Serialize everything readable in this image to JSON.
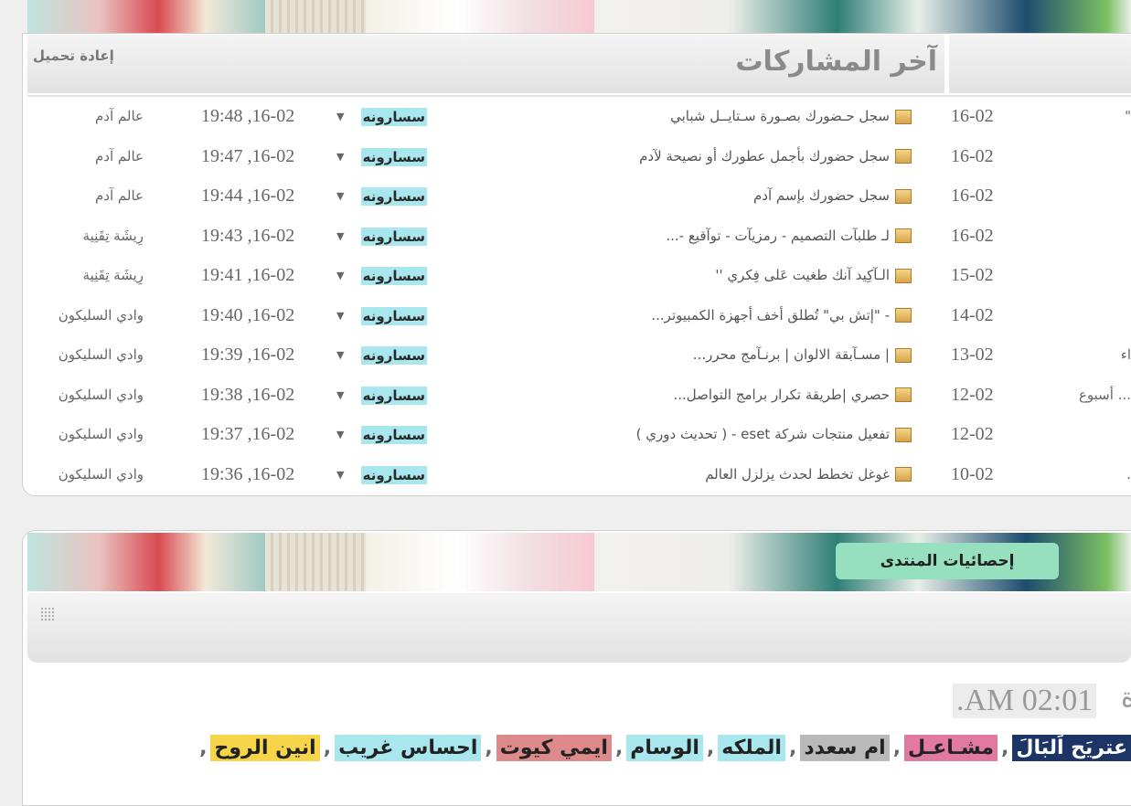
{
  "recent_posts": {
    "title": "آخر المشاركات",
    "reload_label": "إعادة تحميل",
    "left_edge_fragments": [
      "\"",
      "",
      "",
      "",
      "",
      "",
      "اء",
      "أسبوع ...",
      "",
      "."
    ],
    "rows": [
      {
        "date": "16-02",
        "topic": "سجل حـضورك بصـورة سـتايــل شبابي",
        "user": "سسارونه",
        "time": "19:48 ,16-02",
        "forum": "عالم آدم"
      },
      {
        "date": "16-02",
        "topic": "سجل حضورك بأجمل عطورك أو نصيحة لآدم",
        "user": "سسارونه",
        "time": "19:47 ,16-02",
        "forum": "عالم آدم"
      },
      {
        "date": "16-02",
        "topic": "سجل حضورك بإسم آدم",
        "user": "سسارونه",
        "time": "19:44 ,16-02",
        "forum": "عالم آدم"
      },
      {
        "date": "16-02",
        "topic": "لـ طلبآت التصميم - رمزيآت - توآقيع -...",
        "user": "سسارونه",
        "time": "19:43 ,16-02",
        "forum": "رِيشَة تِقَنِية"
      },
      {
        "date": "15-02",
        "topic": "الـآكِيد آنك طغيت عَلى فِكري ''",
        "user": "سسارونه",
        "time": "19:41 ,16-02",
        "forum": "رِيشَة تِقَنِية"
      },
      {
        "date": "14-02",
        "topic": "- \"إتش بي\" تُطلق أخف أجهزة الكمبيوتر...",
        "user": "سسارونه",
        "time": "19:40 ,16-02",
        "forum": "وادي السليكون"
      },
      {
        "date": "13-02",
        "topic": "| مسـآبقة الالوان | برنـآمج محرر...",
        "user": "سسارونه",
        "time": "19:39 ,16-02",
        "forum": "وادي السليكون"
      },
      {
        "date": "12-02",
        "topic": "حصري |طريقة تكرار برامج التواصل...",
        "user": "سسارونه",
        "time": "19:38 ,16-02",
        "forum": "وادي السليكون"
      },
      {
        "date": "12-02",
        "topic": "تفعيل منتجات شركة eset - ( تحديث دوري )",
        "user": "سسارونه",
        "time": "19:37 ,16-02",
        "forum": "وادي السليكون"
      },
      {
        "date": "10-02",
        "topic": "غوغل تخطط لحدث يزلزل العالم",
        "user": "سسارونه",
        "time": "19:36 ,16-02",
        "forum": "وادي السليكون"
      }
    ]
  },
  "forum_stats": {
    "title": "إحصائيات المنتدى",
    "toggle_icon": "grid-dots-icon",
    "time_text": ".AM 02:01",
    "time_prefix_fragment": "ة",
    "online_users": [
      {
        "name": "عتريَح اَلبَالَ",
        "bg": "#1c3566",
        "fg": "#ffffff"
      },
      {
        "name": "مشـاعـل",
        "bg": "#e27aa0",
        "fg": "#222222"
      },
      {
        "name": "ام سعدد",
        "bg": "#b9b9b9",
        "fg": "#222222"
      },
      {
        "name": "الملكه",
        "bg": "#a9e7ee",
        "fg": "#222222"
      },
      {
        "name": "الوسام",
        "bg": "#a9e7ee",
        "fg": "#222222"
      },
      {
        "name": "ايمي كيوت",
        "bg": "#de8a8a",
        "fg": "#222222"
      },
      {
        "name": "احساس غريب",
        "bg": "#a9e7ee",
        "fg": "#222222"
      },
      {
        "name": "انين الروح",
        "bg": "#f6d54a",
        "fg": "#222222"
      }
    ],
    "separator": ","
  },
  "colors": {
    "user_highlight": "#a9e7ee",
    "stats_badge": "#97e0bf",
    "panel_border": "#cfcfcf"
  }
}
